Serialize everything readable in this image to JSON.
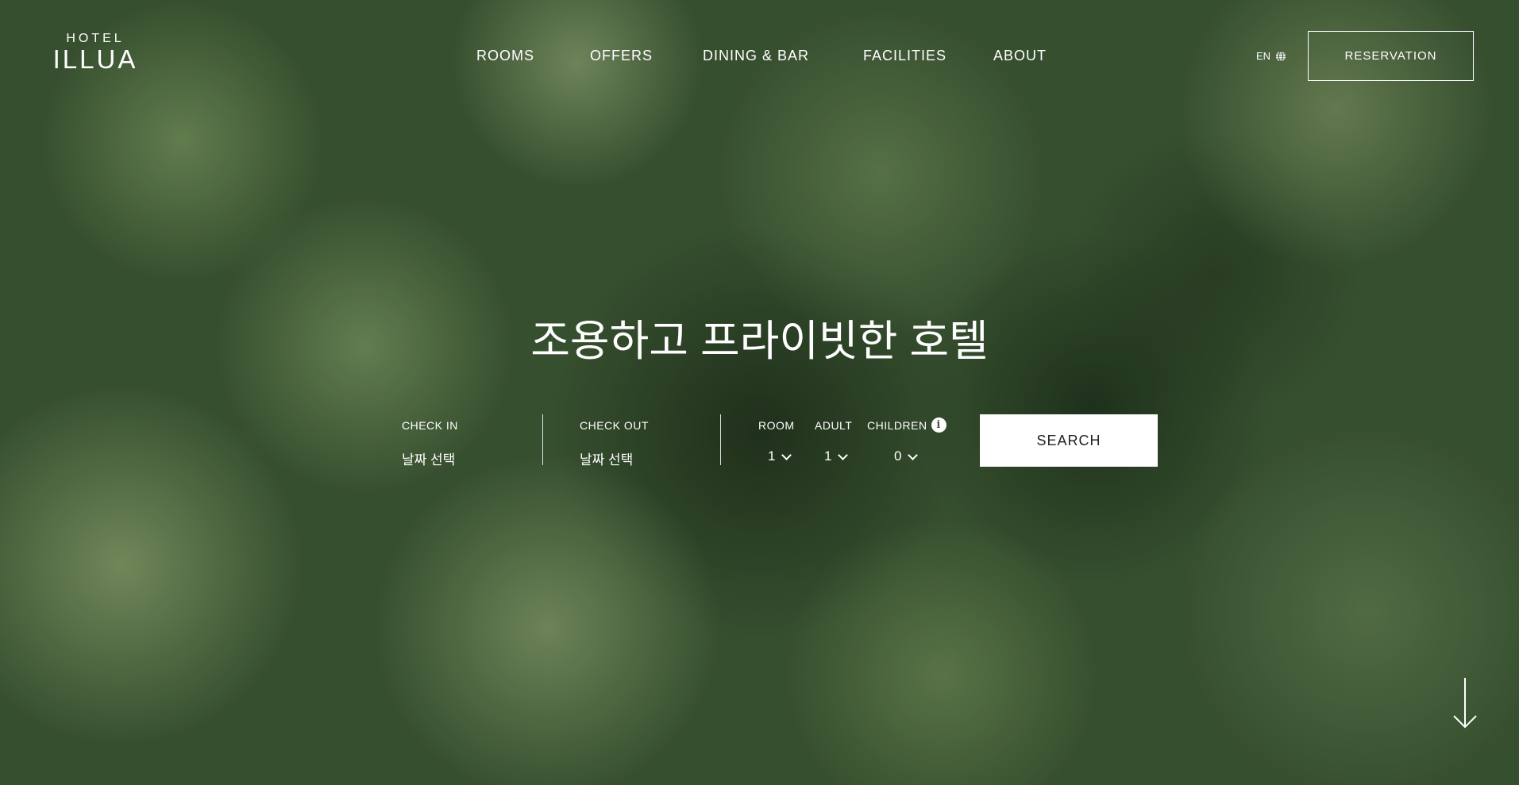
{
  "brand": {
    "top": "HOTEL",
    "name": "ILLUA"
  },
  "nav": {
    "items": [
      "ROOMS",
      "OFFERS",
      "DINING & BAR",
      "FACILITIES",
      "ABOUT"
    ],
    "language": "EN",
    "reservation": "RESERVATION"
  },
  "hero": {
    "headline": "조용하고 프라이빗한 호텔"
  },
  "booking": {
    "check_in_label": "CHECK IN",
    "check_in_value": "날짜 선택",
    "check_out_label": "CHECK OUT",
    "check_out_value": "날짜 선택",
    "room_label": "ROOM",
    "room_value": "1",
    "adult_label": "ADULT",
    "adult_value": "1",
    "children_label": "CHILDREN",
    "children_value": "0",
    "search_label": "SEARCH"
  },
  "icons": {
    "language": "globe-icon",
    "children_info": "info-icon",
    "dropdown": "chevron-down-icon",
    "scroll": "arrow-down-icon"
  },
  "colors": {
    "text": "#ffffff",
    "button_bg": "#ffffff",
    "button_text": "#222222",
    "background": "#3e5a35"
  }
}
